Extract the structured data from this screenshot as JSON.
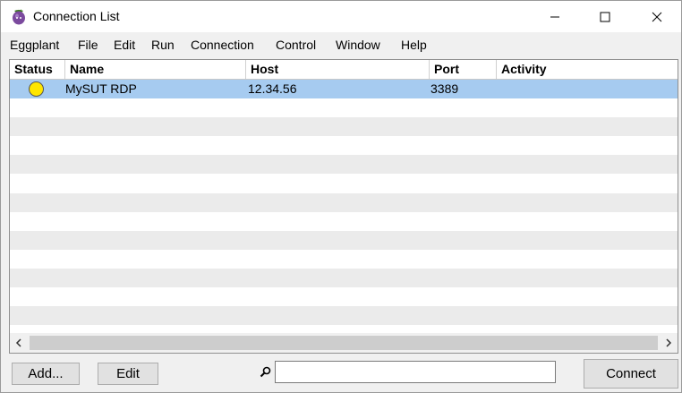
{
  "window": {
    "title": "Connection List"
  },
  "menu": [
    "Eggplant",
    "File",
    "Edit",
    "Run",
    "Connection",
    "Control",
    "Window",
    "Help"
  ],
  "table": {
    "columns": [
      "Status",
      "Name",
      "Host",
      "Port",
      "Activity"
    ],
    "rows": [
      {
        "status_color": "#ffe600",
        "name": "MySUT RDP",
        "host": "12.34.56",
        "port": "3389",
        "activity": "",
        "selected": true
      }
    ],
    "empty_row_count": 13
  },
  "bottom": {
    "add_label": "Add...",
    "edit_label": "Edit",
    "search_value": "",
    "connect_label": "Connect"
  },
  "icons": {
    "app": "eggplant-app-icon",
    "search": "search-icon",
    "minimize": "minimize-icon",
    "maximize": "maximize-icon",
    "close": "close-icon",
    "scroll_left": "chevron-left-icon",
    "scroll_right": "chevron-right-icon"
  },
  "colors": {
    "selection": "#a6cbf0",
    "alt_row": "#ebebeb"
  }
}
